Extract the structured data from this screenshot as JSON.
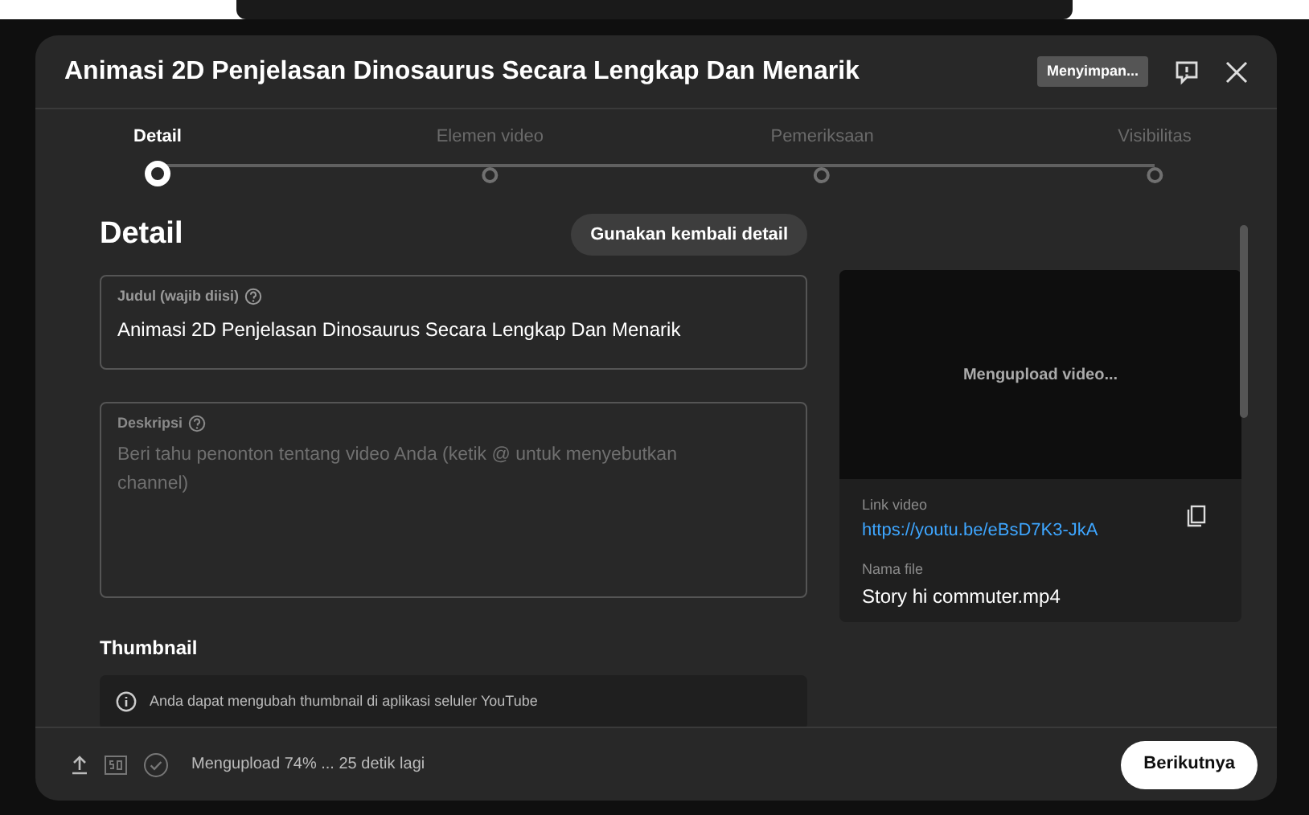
{
  "dialog": {
    "title": "Animasi 2D Penjelasan Dinosaurus Secara Lengkap Dan Menarik",
    "save_status": "Menyimpan..."
  },
  "steps": [
    {
      "label": "Detail",
      "selected": true
    },
    {
      "label": "Elemen video",
      "selected": false
    },
    {
      "label": "Pemeriksaan",
      "selected": false
    },
    {
      "label": "Visibilitas",
      "selected": false
    }
  ],
  "section_title": "Detail",
  "reuse_button": "Gunakan kembali detail",
  "title_field": {
    "label": "Judul (wajib diisi)",
    "value": "Animasi 2D Penjelasan Dinosaurus Secara Lengkap Dan Menarik"
  },
  "description_field": {
    "label": "Deskripsi",
    "placeholder": "Beri tahu penonton tentang video Anda (ketik @ untuk menyebutkan channel)"
  },
  "thumbnail": {
    "heading": "Thumbnail",
    "info": "Anda dapat mengubah thumbnail di aplikasi seluler YouTube"
  },
  "video_card": {
    "status": "Mengupload video...",
    "link_label": "Link video",
    "link": "https://youtu.be/eBsD7K3-JkA",
    "file_label": "Nama file",
    "file_name": "Story hi commuter.mp4"
  },
  "footer": {
    "progress_text": "Mengupload 74% ... 25 detik lagi",
    "next_button": "Berikutnya"
  }
}
